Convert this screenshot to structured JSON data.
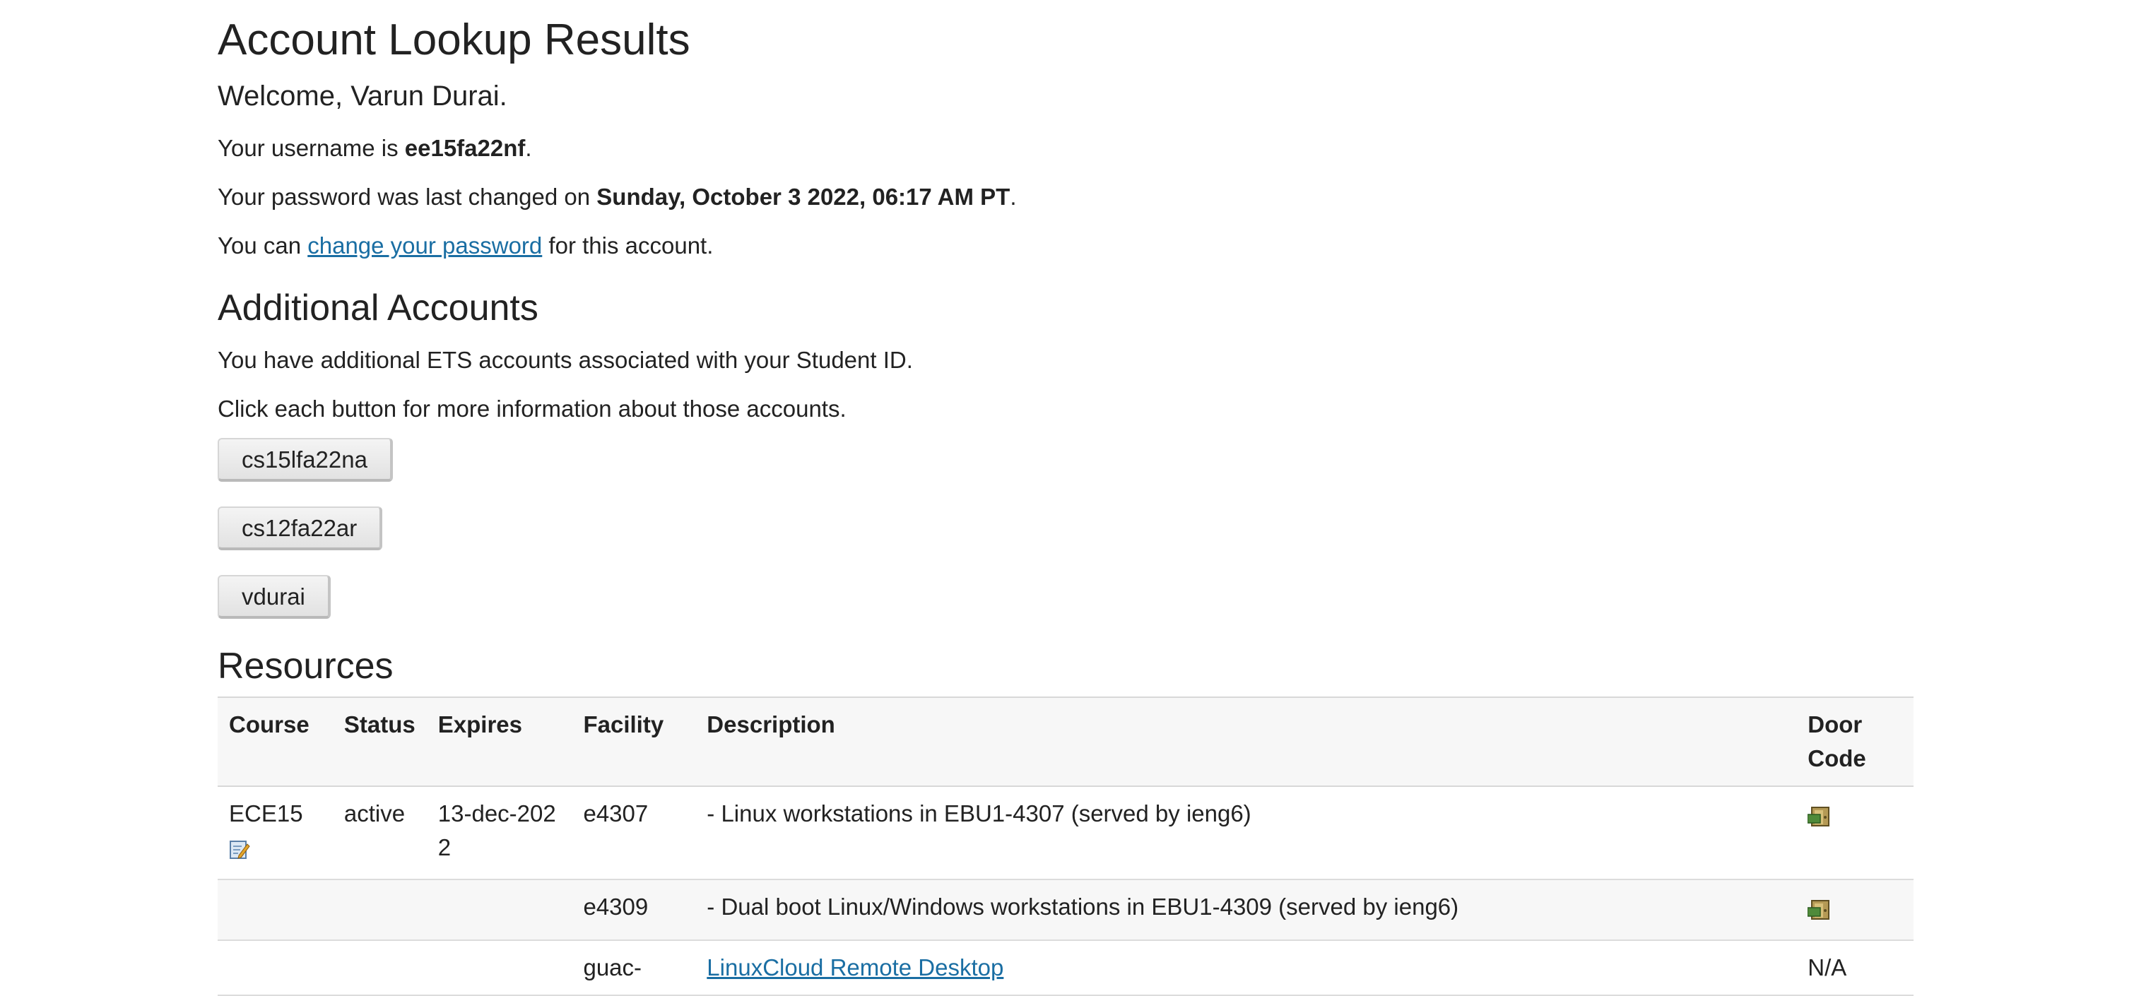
{
  "header": {
    "title": "Account Lookup Results",
    "welcome": "Welcome, Varun Durai."
  },
  "account": {
    "username_prefix": "Your username is ",
    "username": "ee15fa22nf",
    "username_suffix": ".",
    "password_prefix": "Your password was last changed on ",
    "password_date": "Sunday, October 3 2022, 06:17 AM PT",
    "password_suffix": ".",
    "change_prefix": "You can ",
    "change_link": "change your password",
    "change_suffix": " for this account."
  },
  "additional": {
    "title": "Additional Accounts",
    "line1": "You have additional ETS accounts associated with your Student ID.",
    "line2": "Click each button for more information about those accounts.",
    "buttons": [
      "cs15lfa22na",
      "cs12fa22ar",
      "vdurai"
    ]
  },
  "resources": {
    "title": "Resources",
    "headers": [
      "Course",
      "Status",
      "Expires",
      "Facility",
      "Description",
      "Door Code"
    ],
    "rows": [
      {
        "course": "ECE15",
        "status": "active",
        "expires": "13-dec-2022",
        "facility": "e4307",
        "description": "- Linux workstations in EBU1-4307 (served by ieng6)",
        "door": "door-icon"
      },
      {
        "course": "",
        "status": "",
        "expires": "",
        "facility": "e4309",
        "description": "- Dual boot Linux/Windows workstations in EBU1-4309 (served by ieng6)",
        "door": "door-icon"
      },
      {
        "course": "",
        "status": "",
        "expires": "",
        "facility": "guac-",
        "description_link": "LinuxCloud Remote Desktop",
        "door": "N/A"
      }
    ]
  },
  "colors": {
    "link": "#1a6ea3",
    "text": "#222222",
    "header_bg": "#f7f7f7"
  }
}
